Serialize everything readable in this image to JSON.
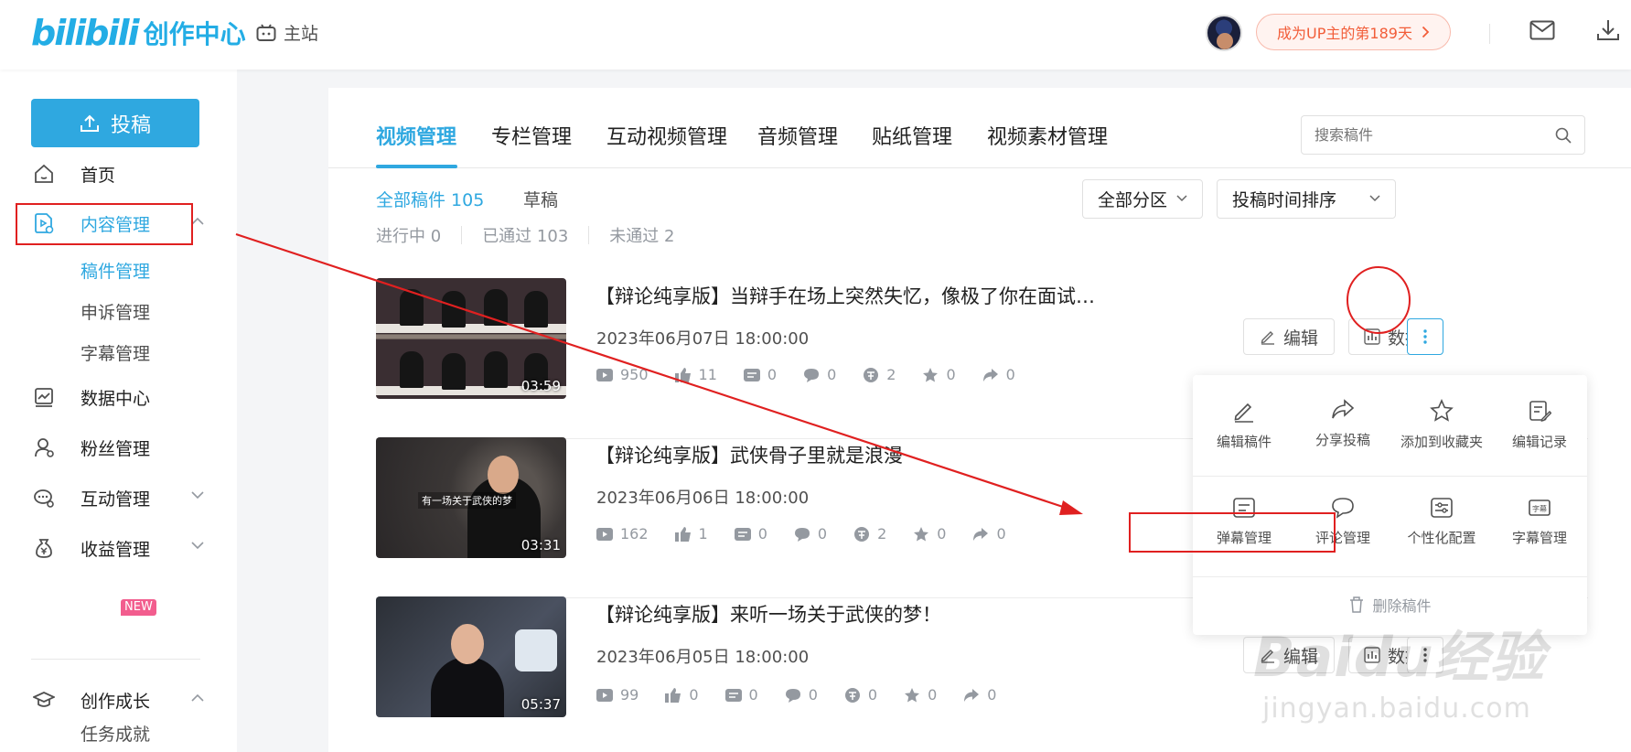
{
  "topbar": {
    "logo_bili": "bilibili",
    "logo_text": "创作中心",
    "main_site": "主站",
    "days_badge": "成为UP主的第189天"
  },
  "sidebar": {
    "post_button": "投稿",
    "items": [
      {
        "label": "首页",
        "icon": "home-icon"
      },
      {
        "label": "内容管理",
        "icon": "content-icon"
      },
      {
        "label": "数据中心",
        "icon": "chart-icon"
      },
      {
        "label": "粉丝管理",
        "icon": "fans-icon"
      },
      {
        "label": "互动管理",
        "icon": "interact-icon"
      },
      {
        "label": "收益管理",
        "icon": "money-bag-icon"
      },
      {
        "label": "创作成长",
        "icon": "grad-cap-icon"
      }
    ],
    "sub_items": [
      "稿件管理",
      "申诉管理",
      "字幕管理",
      "任务成就"
    ],
    "new_badge": "NEW"
  },
  "tabs": [
    "视频管理",
    "专栏管理",
    "互动视频管理",
    "音频管理",
    "贴纸管理",
    "视频素材管理"
  ],
  "search": {
    "placeholder": "搜索稿件"
  },
  "filters": {
    "all_label": "全部稿件 105",
    "draft_label": "草稿",
    "status": [
      "进行中 0",
      "已通过 103",
      "未通过 2"
    ],
    "zone_select": "全部分区",
    "sort_select": "投稿时间排序"
  },
  "videos": [
    {
      "title": "【辩论纯享版】当辩手在场上突然失忆，像极了你在面试…",
      "date": "2023年06月07日 18:00:00",
      "duration": "03:59",
      "stats": [
        "950",
        "11",
        "0",
        "0",
        "2",
        "0",
        "0"
      ]
    },
    {
      "title": "【辩论纯享版】武侠骨子里就是浪漫",
      "date": "2023年06月06日 18:00:00",
      "duration": "03:31",
      "stats": [
        "162",
        "1",
        "0",
        "0",
        "2",
        "0",
        "0"
      ],
      "caption": "有一场关于武侠的梦"
    },
    {
      "title": "【辩论纯享版】来听一场关于武侠的梦！",
      "date": "2023年06月05日 18:00:00",
      "duration": "05:37",
      "stats": [
        "99",
        "0",
        "0",
        "0",
        "0",
        "0",
        "0"
      ]
    }
  ],
  "actions": {
    "edit": "编辑",
    "data": "数据"
  },
  "popup": {
    "row1": [
      "编辑稿件",
      "分享投稿",
      "添加到收藏夹",
      "编辑记录"
    ],
    "row2": [
      "弹幕管理",
      "评论管理",
      "个性化配置",
      "字幕管理"
    ],
    "delete": "删除稿件"
  },
  "watermark": {
    "main": "Baidu经验",
    "sub": "jingyan.baidu.com"
  },
  "colors": {
    "accent": "#2fa8e0",
    "annotation": "#e02020",
    "badge": "#f25d39"
  }
}
